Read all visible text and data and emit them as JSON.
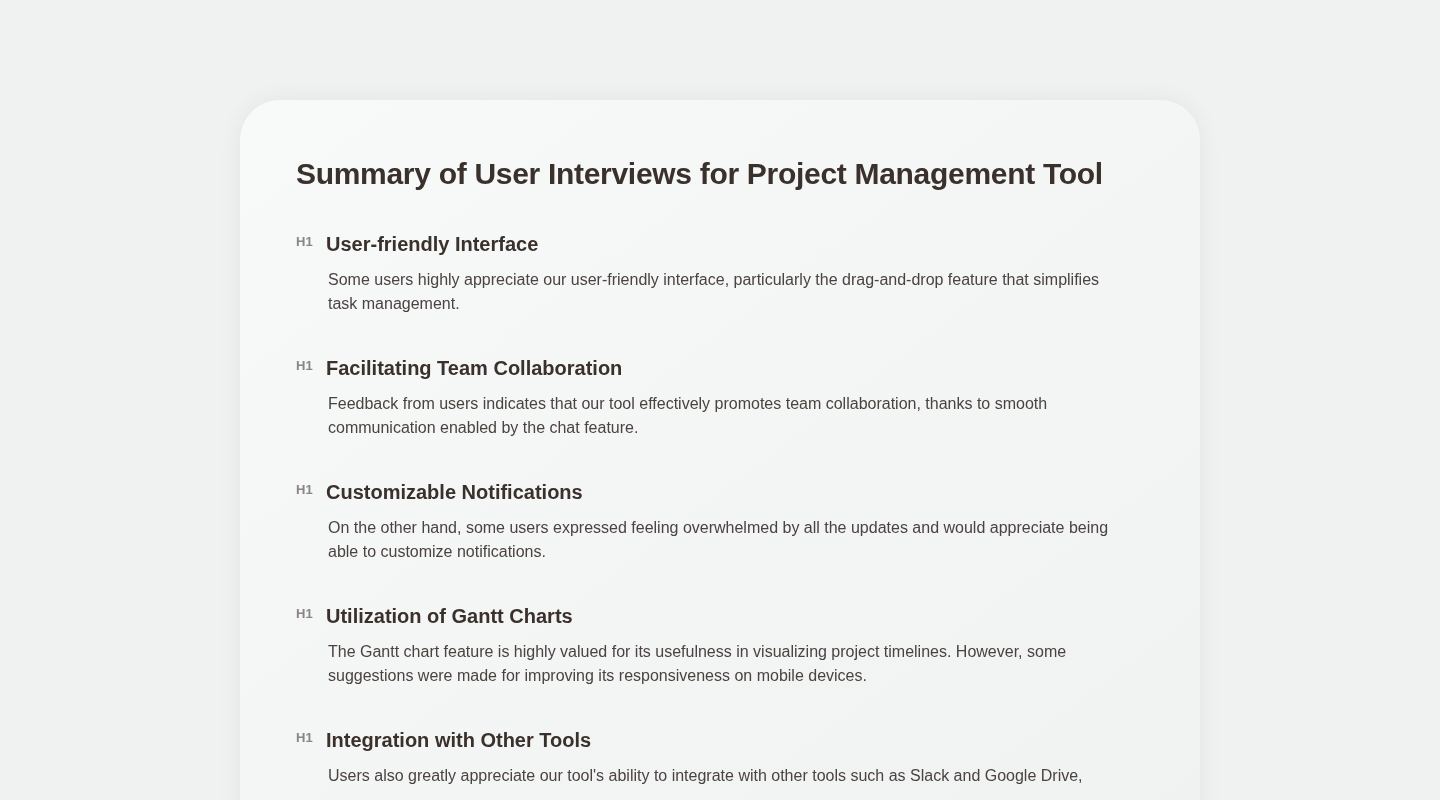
{
  "title": "Summary of User Interviews for Project Management Tool",
  "sections": [
    {
      "level": "H1",
      "heading": "User-friendly Interface",
      "body": "Some users highly appreciate our user-friendly interface, particularly the drag-and-drop feature that simplifies task management."
    },
    {
      "level": "H1",
      "heading": "Facilitating Team Collaboration",
      "body": "Feedback from users indicates that our tool effectively promotes team collaboration, thanks to smooth communication enabled by the chat feature."
    },
    {
      "level": "H1",
      "heading": "Customizable Notifications",
      "body": "On the other hand, some users expressed feeling overwhelmed by all the updates and would appreciate being able to customize notifications."
    },
    {
      "level": "H1",
      "heading": "Utilization of Gantt Charts",
      "body": "The Gantt chart feature is highly valued for its usefulness in visualizing project timelines. However, some suggestions were made for improving its responsiveness on mobile devices."
    },
    {
      "level": "H1",
      "heading": "Integration with Other Tools",
      "body": "Users also greatly appreciate our tool's ability to integrate with other tools such as Slack and Google Drive,"
    }
  ]
}
